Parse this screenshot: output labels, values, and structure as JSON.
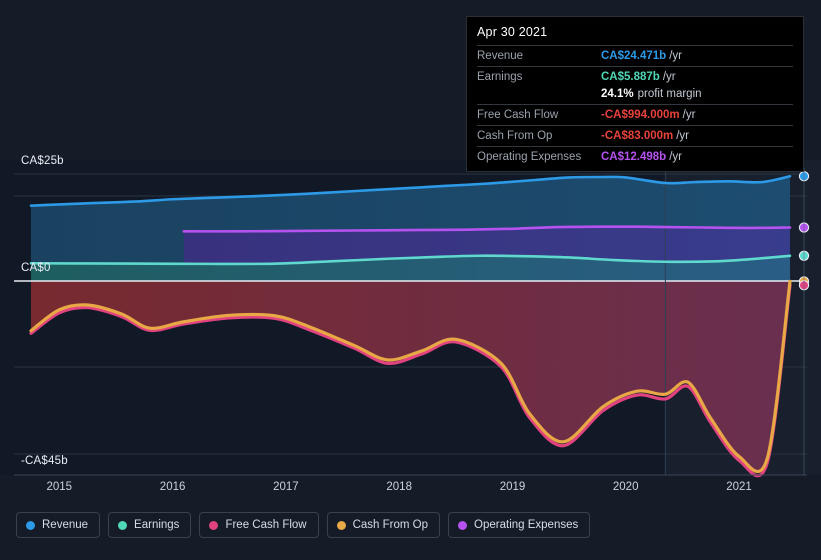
{
  "chart_data": {
    "type": "area",
    "title": "",
    "xlabel": "",
    "ylabel": "",
    "currency": "CA$",
    "ylim": [
      -45,
      25
    ],
    "y_ticks": [
      {
        "value": 25,
        "label": "CA$25b"
      },
      {
        "value": 0,
        "label": "CA$0"
      },
      {
        "value": -45,
        "label": "-CA$45b"
      }
    ],
    "x_ticks": [
      "2015",
      "2016",
      "2017",
      "2018",
      "2019",
      "2020",
      "2021"
    ],
    "x_range": [
      "2014.6",
      "2021.6"
    ],
    "grid": true,
    "legend_position": "bottom",
    "forecast_divider_year": "2020.35",
    "series": [
      {
        "name": "Revenue",
        "color": "#2d9ae8",
        "fill": "#1d4667",
        "x": [
          2014.75,
          2015.0,
          2015.3,
          2015.7,
          2016.0,
          2016.4,
          2016.8,
          2017.2,
          2017.6,
          2018.0,
          2018.4,
          2018.8,
          2019.2,
          2019.5,
          2019.8,
          2020.0,
          2020.35,
          2020.6,
          2020.9,
          2021.2,
          2021.45
        ],
        "values": [
          17.6,
          17.9,
          18.2,
          18.6,
          19.1,
          19.5,
          19.9,
          20.4,
          21.0,
          21.6,
          22.2,
          22.8,
          23.6,
          24.2,
          24.3,
          24.2,
          22.9,
          23.1,
          23.3,
          23.1,
          24.471
        ]
      },
      {
        "name": "Earnings",
        "color": "#5fd9cd",
        "fill": "#1f5d63",
        "x": [
          2014.75,
          2015.2,
          2015.8,
          2016.3,
          2016.9,
          2017.4,
          2017.9,
          2018.3,
          2018.7,
          2019.1,
          2019.5,
          2019.9,
          2020.35,
          2020.8,
          2021.1,
          2021.45
        ],
        "values": [
          4.15,
          4.1,
          4.05,
          4.0,
          4.05,
          4.6,
          5.2,
          5.6,
          5.9,
          5.8,
          5.5,
          4.9,
          4.5,
          4.6,
          5.1,
          5.887
        ]
      },
      {
        "name": "Free Cash Flow",
        "color": "#e0437f",
        "fill": "none",
        "x": [
          2014.75,
          2015.0,
          2015.25,
          2015.55,
          2015.8,
          2016.1,
          2016.5,
          2016.9,
          2017.2,
          2017.6,
          2017.9,
          2018.2,
          2018.5,
          2018.9,
          2019.15,
          2019.45,
          2019.8,
          2020.1,
          2020.35,
          2020.55,
          2020.75,
          2021.0,
          2021.25,
          2021.45
        ],
        "values": [
          -12.2,
          -7.4,
          -6.2,
          -8.3,
          -11.5,
          -10.0,
          -8.6,
          -8.7,
          -11.3,
          -15.6,
          -19.2,
          -17.0,
          -14.2,
          -20.0,
          -31.8,
          -38.4,
          -30.2,
          -26.6,
          -27.5,
          -24.6,
          -33.0,
          -41.8,
          -42.3,
          -0.994
        ]
      },
      {
        "name": "Cash From Op",
        "color": "#e8a845",
        "fill": "#7e2c33",
        "x": [
          2014.75,
          2015.0,
          2015.25,
          2015.55,
          2015.8,
          2016.1,
          2016.5,
          2016.9,
          2017.2,
          2017.6,
          2017.9,
          2018.2,
          2018.5,
          2018.9,
          2019.15,
          2019.45,
          2019.8,
          2020.1,
          2020.35,
          2020.55,
          2020.75,
          2021.0,
          2021.25,
          2021.45
        ],
        "values": [
          -11.6,
          -6.7,
          -5.6,
          -7.7,
          -11.0,
          -9.5,
          -8.0,
          -8.1,
          -10.6,
          -15.0,
          -18.4,
          -16.3,
          -13.6,
          -19.2,
          -30.9,
          -37.5,
          -29.3,
          -25.7,
          -26.4,
          -23.6,
          -32.0,
          -40.9,
          -41.3,
          -0.083
        ]
      },
      {
        "name": "Operating Expenses",
        "color": "#b653f0",
        "fill": "#3c3283",
        "x": [
          2016.1,
          2016.6,
          2017.1,
          2017.6,
          2018.1,
          2018.6,
          2019.0,
          2019.4,
          2019.8,
          2020.1,
          2020.35,
          2020.7,
          2021.1,
          2021.45
        ],
        "values": [
          11.6,
          11.6,
          11.7,
          11.8,
          11.9,
          12.0,
          12.2,
          12.6,
          12.7,
          12.7,
          12.6,
          12.5,
          12.4,
          12.498
        ]
      }
    ],
    "endpoint_markers": [
      {
        "series": "Revenue",
        "color": "#2d9ae8",
        "value": 24.471
      },
      {
        "series": "Operating Expenses",
        "color": "#b653f0",
        "value": 12.498
      },
      {
        "series": "Earnings",
        "color": "#5fd9cd",
        "value": 5.887
      },
      {
        "series": "Cash From Op",
        "color": "#e8a845",
        "value": -0.083
      },
      {
        "series": "Free Cash Flow",
        "color": "#e0437f",
        "value": -0.994
      }
    ]
  },
  "tooltip": {
    "date": "Apr 30 2021",
    "rows": [
      {
        "label": "Revenue",
        "value": "CA$24.471b",
        "unit": "/yr",
        "color": "#2d9ae8"
      },
      {
        "label": "Earnings",
        "value": "CA$5.887b",
        "unit": "/yr",
        "color": "#4fd8b6"
      },
      {
        "label": "",
        "value": "24.1%",
        "unit": "profit margin",
        "color": "#ffffff"
      },
      {
        "label": "Free Cash Flow",
        "value": "-CA$994.000m",
        "unit": "/yr",
        "color": "#e8433a"
      },
      {
        "label": "Cash From Op",
        "value": "-CA$83.000m",
        "unit": "/yr",
        "color": "#e8433a"
      },
      {
        "label": "Operating Expenses",
        "value": "CA$12.498b",
        "unit": "/yr",
        "color": "#b653f0"
      }
    ]
  },
  "legend": {
    "items": [
      {
        "label": "Revenue",
        "color": "#2d9ae8"
      },
      {
        "label": "Earnings",
        "color": "#4fd8b6"
      },
      {
        "label": "Free Cash Flow",
        "color": "#e0437f"
      },
      {
        "label": "Cash From Op",
        "color": "#e8a845"
      },
      {
        "label": "Operating Expenses",
        "color": "#b653f0"
      }
    ]
  }
}
